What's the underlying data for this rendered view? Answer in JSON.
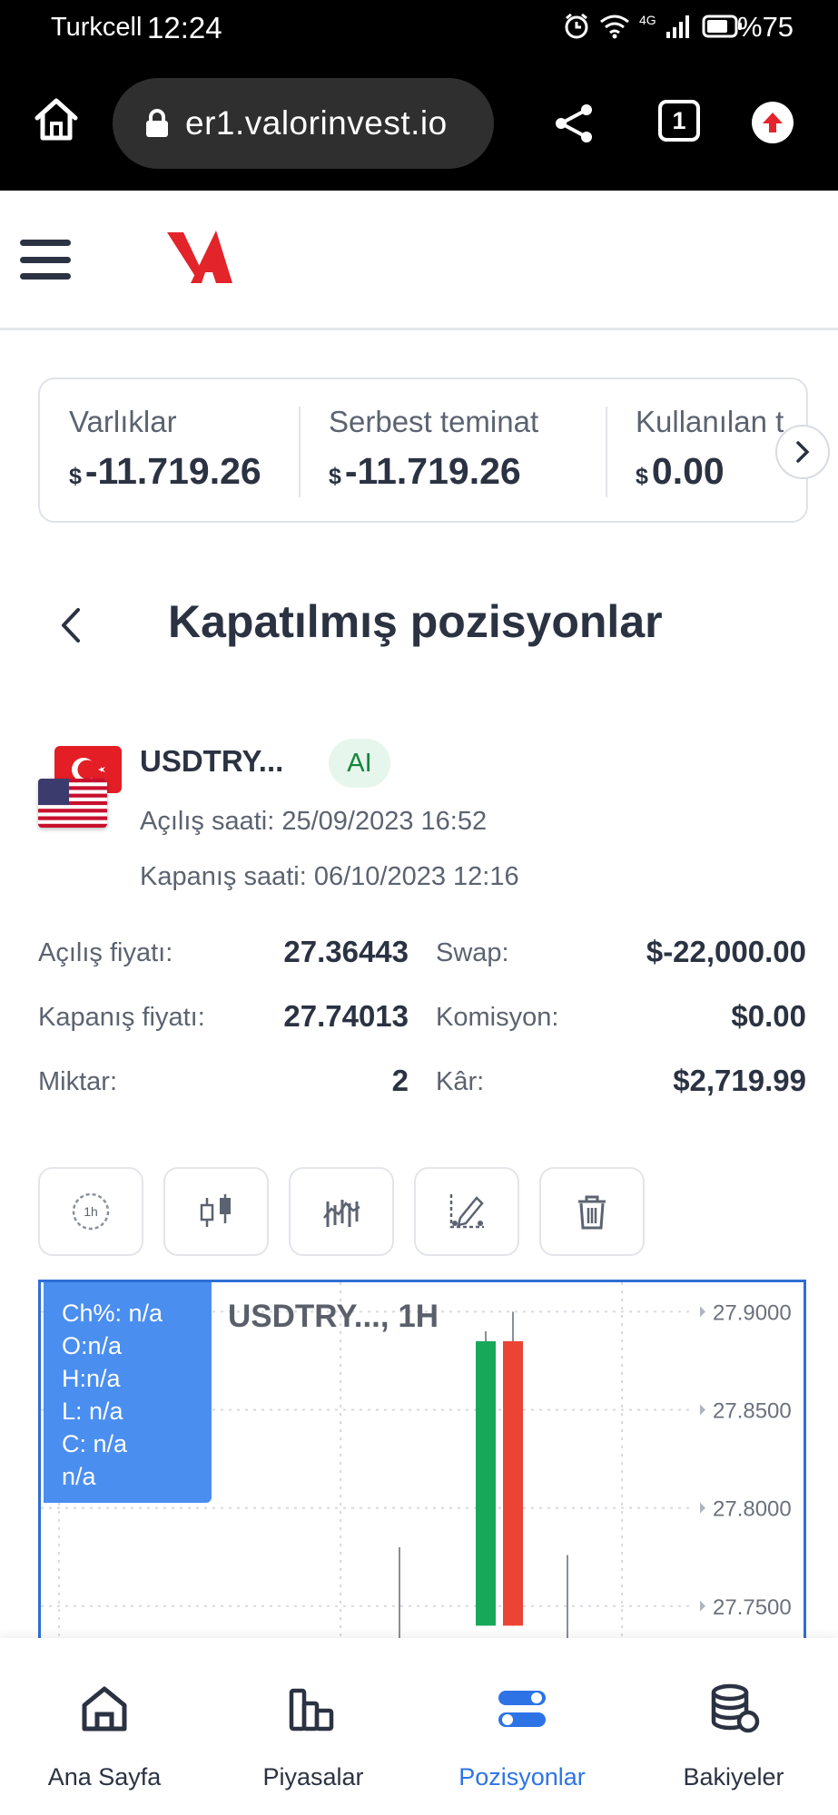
{
  "status_bar": {
    "carrier": "Turkcell",
    "time": "12:24",
    "network": "4G",
    "battery": "%75"
  },
  "browser": {
    "url": "er1.valorinvest.io",
    "tab_count": "1"
  },
  "summary": {
    "items": [
      {
        "label": "Varlıklar",
        "currency": "$",
        "value": "-11.719.26"
      },
      {
        "label": "Serbest teminat",
        "currency": "$",
        "value": "-11.719.26"
      },
      {
        "label": "Kullanılan t",
        "currency": "$",
        "value": "0.00"
      }
    ]
  },
  "page": {
    "title": "Kapatılmış pozisyonlar"
  },
  "position": {
    "symbol": "USDTRY...",
    "badge": "AI",
    "open_time": "Açılış saati: 25/09/2023 16:52",
    "close_time": "Kapanış saati: 06/10/2023 12:16",
    "open_price_label": "Açılış fiyatı:",
    "open_price": "27.36443",
    "close_price_label": "Kapanış fiyatı:",
    "close_price": "27.74013",
    "quantity_label": "Miktar:",
    "quantity": "2",
    "swap_label": "Swap:",
    "swap": "$-22,000.00",
    "commission_label": "Komisyon:",
    "commission": "$0.00",
    "profit_label": "Kâr:",
    "profit": "$2,719.99"
  },
  "chart_toolbar": {
    "interval_label": "1h",
    "icons": [
      "interval-icon",
      "candlestick-icon",
      "indicators-icon",
      "drawing-icon",
      "trash-icon"
    ]
  },
  "chart_data": {
    "type": "candlestick",
    "title": "USDTRY..., 1H",
    "legend": [
      "Ch%: n/a",
      "O:n/a",
      "H:n/a",
      "L: n/a",
      "C: n/a",
      "n/a"
    ],
    "y_ticks": [
      "27.9000",
      "27.8500",
      "27.8000",
      "27.7500"
    ],
    "ylim": [
      27.73,
      27.915
    ],
    "candles": [
      {
        "id": "c1",
        "open": 27.74,
        "close": 27.74,
        "high": 27.78,
        "low": 27.73,
        "color": "#9aa0a8"
      },
      {
        "id": "c2",
        "open": 27.74,
        "close": 27.885,
        "high": 27.89,
        "low": 27.74,
        "color": "#17a85a"
      },
      {
        "id": "c3",
        "open": 27.885,
        "close": 27.74,
        "high": 27.9,
        "low": 27.74,
        "color": "#ec4434"
      },
      {
        "id": "c4",
        "open": 27.74,
        "close": 27.74,
        "high": 27.776,
        "low": 27.73,
        "color": "#9aa0a8"
      }
    ],
    "colors": {
      "up": "#17a85a",
      "down": "#ec4434",
      "frame": "#2f6fd6",
      "legend": "#4a8ef0"
    }
  },
  "bottom_nav": {
    "items": [
      {
        "label": "Ana Sayfa",
        "icon": "home-icon",
        "active": false
      },
      {
        "label": "Piyasalar",
        "icon": "markets-icon",
        "active": false
      },
      {
        "label": "Pozisyonlar",
        "icon": "positions-icon",
        "active": true
      },
      {
        "label": "Bakiyeler",
        "icon": "balances-icon",
        "active": false
      }
    ]
  },
  "colors": {
    "accent": "#2d73e6",
    "brand_red": "#e3242b",
    "text_dark": "#2b3242",
    "text_muted": "#5c6370"
  }
}
